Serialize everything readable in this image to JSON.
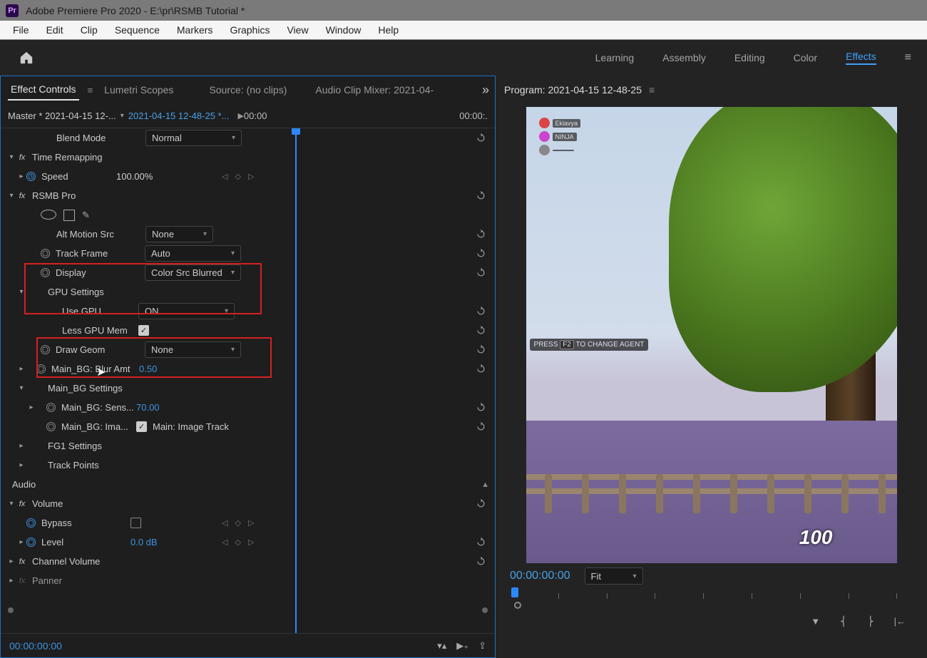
{
  "titlebar": {
    "app_abbr": "Pr",
    "title": "Adobe Premiere Pro 2020 - E:\\pr\\RSMB Tutorial *"
  },
  "menubar": [
    "File",
    "Edit",
    "Clip",
    "Sequence",
    "Markers",
    "Graphics",
    "View",
    "Window",
    "Help"
  ],
  "workspaces": {
    "items": [
      "Learning",
      "Assembly",
      "Editing",
      "Color",
      "Effects"
    ],
    "active": "Effects"
  },
  "left_tabs": {
    "items": [
      "Effect Controls",
      "Lumetri Scopes",
      "Source: (no clips)",
      "Audio Clip Mixer: 2021-04-"
    ],
    "active": "Effect Controls"
  },
  "master_row": {
    "master": "Master * 2021-04-15 12-...",
    "sequence": "2021-04-15 12-48-25 *...",
    "time_left": "00:00",
    "time_right": "00:00:."
  },
  "effects": {
    "blend_mode": {
      "label": "Blend Mode",
      "value": "Normal"
    },
    "time_remapping": {
      "label": "Time Remapping",
      "speed_label": "Speed",
      "speed_value": "100.00%"
    },
    "rsmb": {
      "label": "RSMB Pro",
      "alt_motion": {
        "label": "Alt Motion Src",
        "value": "None"
      },
      "track_frame": {
        "label": "Track Frame",
        "value": "Auto"
      },
      "display": {
        "label": "Display",
        "value": "Color Src Blurred"
      },
      "gpu_settings": {
        "label": "GPU Settings",
        "use_gpu_label": "Use GPU",
        "use_gpu_value": "ON",
        "less_mem_label": "Less GPU Mem"
      },
      "draw_geom": {
        "label": "Draw Geom",
        "value": "None"
      },
      "blur_amt": {
        "label": "Main_BG: Blur Amt",
        "value": "0.50"
      },
      "main_bg_settings": {
        "label": "Main_BG Settings"
      },
      "sens": {
        "label": "Main_BG: Sens...",
        "value": "70.00"
      },
      "ima": {
        "label": "Main_BG: Ima...",
        "check_label": "Main: Image Track"
      },
      "fg1": {
        "label": "FG1 Settings"
      },
      "track_points": {
        "label": "Track Points"
      }
    }
  },
  "audio": {
    "section": "Audio",
    "volume": {
      "label": "Volume",
      "bypass_label": "Bypass",
      "level_label": "Level",
      "level_value": "0.0 dB"
    },
    "channel_volume": "Channel Volume",
    "panner": "Panner"
  },
  "left_footer_tc": "00:00:00:00",
  "program": {
    "title": "Program: 2021-04-15 12-48-25",
    "tc": "00:00:00:00",
    "zoom": "Fit",
    "hud_score": "100",
    "hud_hint_pre": "PRESS",
    "hud_hint_key": "F2",
    "hud_hint_post": "TO CHANGE AGENT",
    "players": [
      "Eklavya",
      "NINJA",
      ""
    ]
  }
}
